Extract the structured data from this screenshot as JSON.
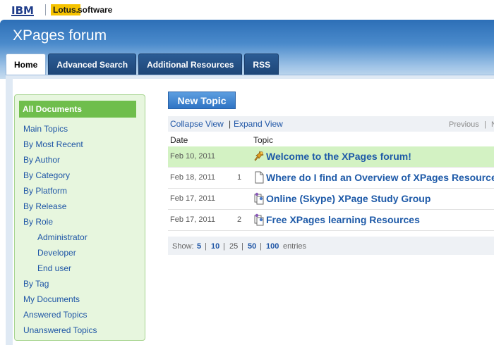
{
  "brand": {
    "company": "IBM",
    "product_badge": "Lotus.",
    "product_suffix": "software"
  },
  "app": {
    "title": "XPages forum"
  },
  "tabs": [
    {
      "label": "Home",
      "active": true
    },
    {
      "label": "Advanced Search",
      "active": false
    },
    {
      "label": "Additional Resources",
      "active": false
    },
    {
      "label": "RSS",
      "active": false
    }
  ],
  "sidebar": {
    "header": "All Documents",
    "items": [
      {
        "label": "Main Topics"
      },
      {
        "label": "By Most Recent"
      },
      {
        "label": "By Author"
      },
      {
        "label": "By Category"
      },
      {
        "label": "By Platform"
      },
      {
        "label": "By Release"
      },
      {
        "label": "By Role"
      },
      {
        "label": "Administrator",
        "sub": true
      },
      {
        "label": "Developer",
        "sub": true
      },
      {
        "label": "End user",
        "sub": true
      },
      {
        "label": "By Tag"
      },
      {
        "label": "My Documents"
      },
      {
        "label": "Answered Topics"
      },
      {
        "label": "Unanswered Topics"
      }
    ]
  },
  "toolbar": {
    "new_topic": "New Topic"
  },
  "view": {
    "collapse": "Collapse View",
    "separator": "|",
    "expand": "Expand View",
    "previous": "Previous",
    "pager_sep": "|",
    "next_partial": "N"
  },
  "table": {
    "columns": {
      "date": "Date",
      "topic": "Topic"
    },
    "rows": [
      {
        "date": "Feb 10, 2011",
        "count": "",
        "icon": "pin-icon",
        "topic": "Welcome to the XPages forum!"
      },
      {
        "date": "Feb 18, 2011",
        "count": "1",
        "icon": "document-icon",
        "topic": "Where do I find an Overview of XPages Resources"
      },
      {
        "date": "Feb 17, 2011",
        "count": "",
        "icon": "discussion-icon",
        "topic": "Online (Skype) XPage Study Group"
      },
      {
        "date": "Feb 17, 2011",
        "count": "2",
        "icon": "discussion-icon",
        "topic": "Free XPages learning Resources"
      }
    ]
  },
  "entries": {
    "show_label": "Show:",
    "options": [
      "5",
      "10",
      "25",
      "50",
      "100"
    ],
    "current": "25",
    "separator": "|",
    "suffix": "entries"
  },
  "colors": {
    "header_blue": "#2d6fb7",
    "tab_dark": "#1e4677",
    "sidebar_green": "#6fbe4c",
    "row_highlight": "#d3f2c3",
    "link_blue": "#1e5aa8",
    "lotus_yellow": "#f6c300"
  }
}
